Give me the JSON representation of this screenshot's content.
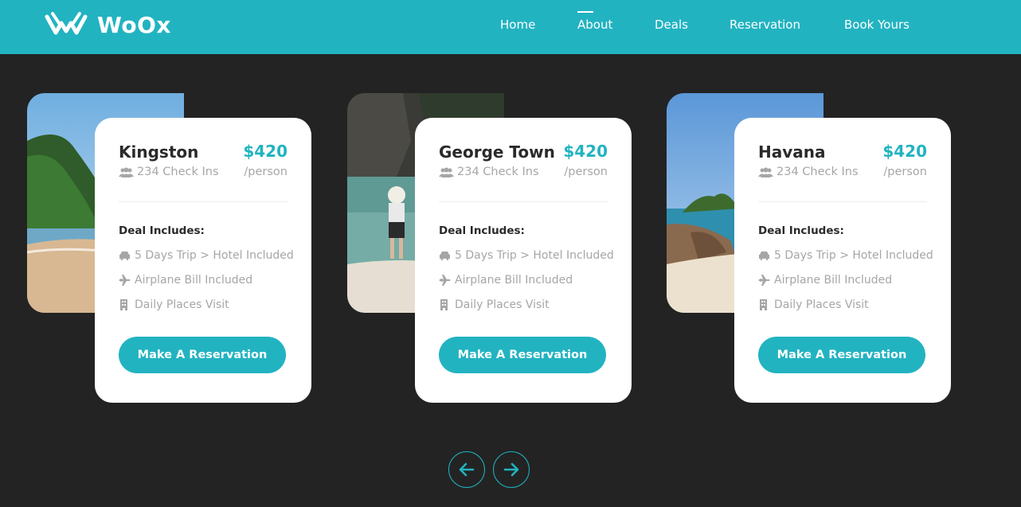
{
  "brand": {
    "name": "WoOx",
    "accent": "#22b3c1",
    "background": "#232323"
  },
  "nav": {
    "items": [
      {
        "label": "Home",
        "active": false
      },
      {
        "label": "About",
        "active": true
      },
      {
        "label": "Deals",
        "active": false
      },
      {
        "label": "Reservation",
        "active": false
      },
      {
        "label": "Book Yours",
        "active": false
      }
    ]
  },
  "deals": [
    {
      "city": "Kingston",
      "price": "$420",
      "per": "/person",
      "checkins": "234 Check Ins",
      "includes_label": "Deal Includes:",
      "features": [
        "5 Days Trip > Hotel Included",
        "Airplane Bill Included",
        "Daily Places Visit"
      ],
      "button": "Make A Reservation"
    },
    {
      "city": "George Town",
      "price": "$420",
      "per": "/person",
      "checkins": "234 Check Ins",
      "includes_label": "Deal Includes:",
      "features": [
        "5 Days Trip > Hotel Included",
        "Airplane Bill Included",
        "Daily Places Visit"
      ],
      "button": "Make A Reservation"
    },
    {
      "city": "Havana",
      "price": "$420",
      "per": "/person",
      "checkins": "234 Check Ins",
      "includes_label": "Deal Includes:",
      "features": [
        "5 Days Trip > Hotel Included",
        "Airplane Bill Included",
        "Daily Places Visit"
      ],
      "button": "Make A Reservation"
    }
  ],
  "icons": {
    "checkins": "users-icon",
    "features": [
      "car-icon",
      "plane-icon",
      "building-icon"
    ],
    "prev": "arrow-left-icon",
    "next": "arrow-right-icon"
  }
}
